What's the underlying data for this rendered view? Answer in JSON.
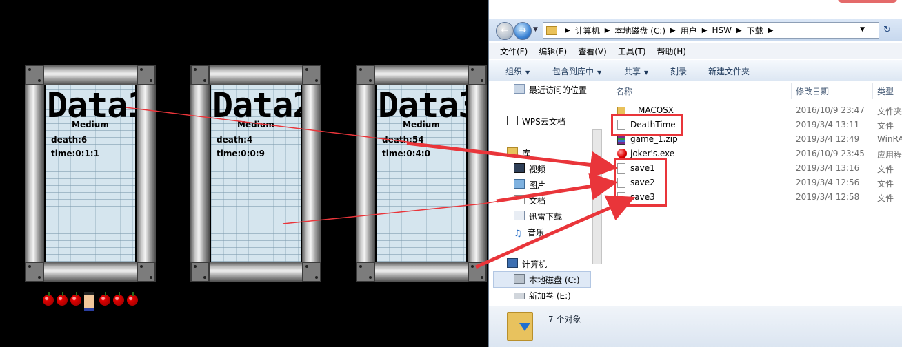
{
  "game": {
    "slots": [
      {
        "title": "Data1",
        "difficulty": "Medium",
        "death": "death:6",
        "time": "time:0:1:1"
      },
      {
        "title": "Data2",
        "difficulty": "Medium",
        "death": "death:4",
        "time": "time:0:0:9"
      },
      {
        "title": "Data3",
        "difficulty": "Medium",
        "death": "death:54",
        "time": "time:0:4:0"
      }
    ]
  },
  "explorer": {
    "breadcrumb": [
      "计算机",
      "本地磁盘 (C:)",
      "用户",
      "HSW",
      "下载"
    ],
    "menu": [
      "文件(F)",
      "编辑(E)",
      "查看(V)",
      "工具(T)",
      "帮助(H)"
    ],
    "toolbar": {
      "organize": "组织",
      "include_library": "包含到库中",
      "share": "共享",
      "burn": "刻录",
      "new_folder": "新建文件夹"
    },
    "nav": {
      "recent": "最近访问的位置",
      "wps": "WPS云文档",
      "library": "库",
      "video": "视频",
      "pictures": "图片",
      "documents": "文档",
      "xunlei": "迅雷下载",
      "music": "音乐",
      "computer": "计算机",
      "drive_c": "本地磁盘 (C:)",
      "drive_e": "新加卷 (E:)"
    },
    "columns": {
      "name": "名称",
      "date": "修改日期",
      "type": "类型"
    },
    "files": [
      {
        "name": "MACOSX",
        "date": "2016/10/9 23:47",
        "type": "文件夹",
        "icon": "folder-icon"
      },
      {
        "name": "DeathTime",
        "date": "2019/3/4 13:11",
        "type": "文件",
        "icon": "file-icon"
      },
      {
        "name": "game_1.zip",
        "date": "2019/3/4 12:49",
        "type": "WinRA",
        "icon": "zip-icon"
      },
      {
        "name": "joker's.exe",
        "date": "2016/10/9 23:45",
        "type": "应用程",
        "icon": "exe-icon"
      },
      {
        "name": "save1",
        "date": "2019/3/4 13:16",
        "type": "文件",
        "icon": "file-icon"
      },
      {
        "name": "save2",
        "date": "2019/3/4 12:56",
        "type": "文件",
        "icon": "file-icon"
      },
      {
        "name": "save3",
        "date": "2019/3/4 12:58",
        "type": "文件",
        "icon": "file-icon"
      }
    ],
    "status": "7 个对象"
  },
  "colors": {
    "annotation_red": "#e9353a",
    "panel_blue": "#d5e5ee"
  }
}
